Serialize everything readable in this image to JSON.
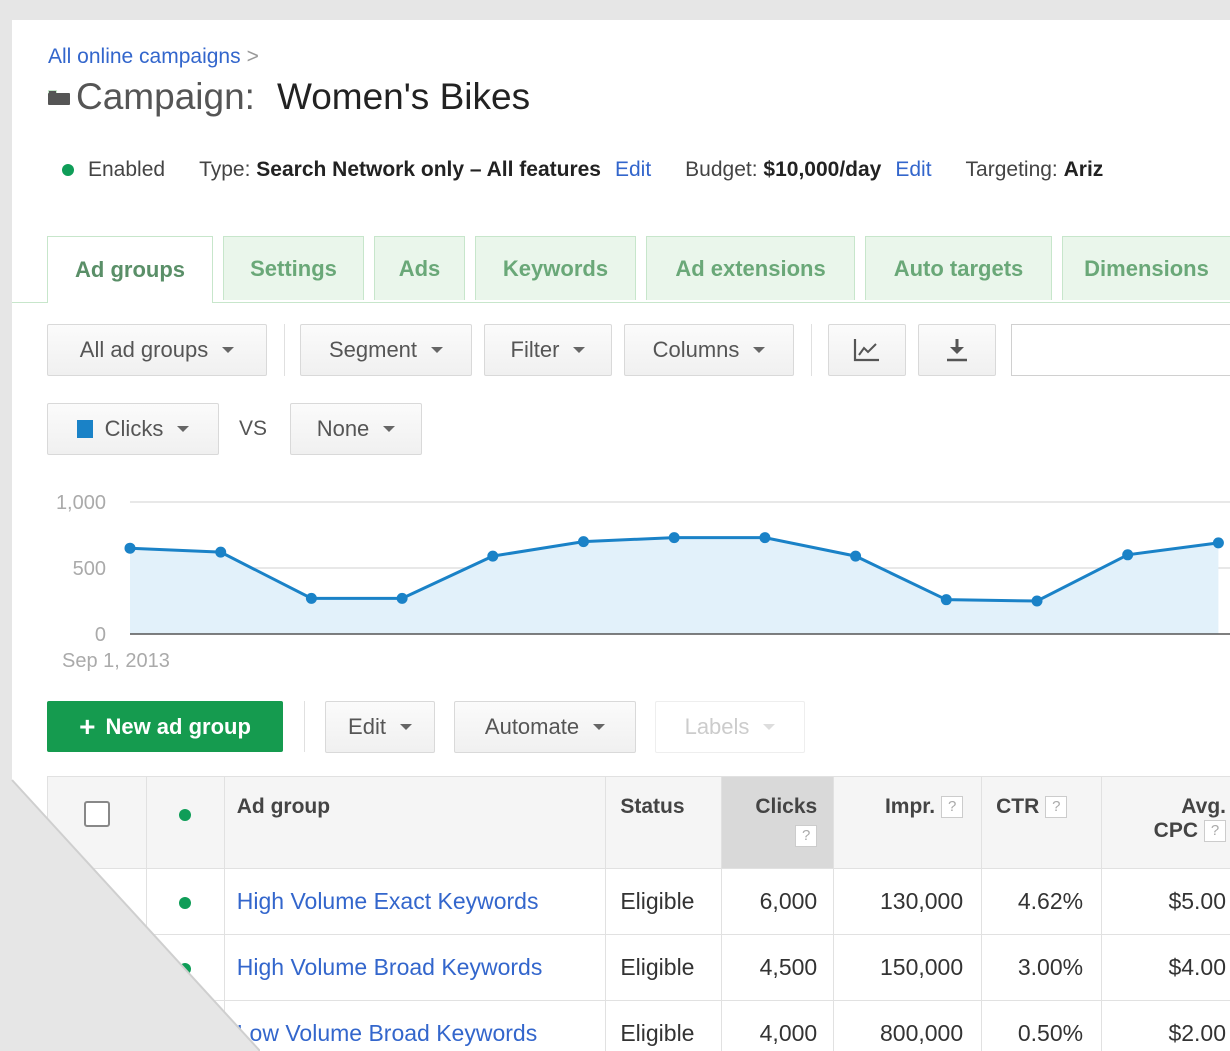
{
  "breadcrumb": {
    "parent": "All online campaigns",
    "sep": ">"
  },
  "campaign": {
    "label": "Campaign:",
    "name": "Women's Bikes"
  },
  "status_bar": {
    "status": "Enabled",
    "type_label": "Type:",
    "type_value": "Search Network only – All features",
    "edit1": "Edit",
    "budget_label": "Budget:",
    "budget_value": "$10,000/day",
    "edit2": "Edit",
    "targeting_label": "Targeting:",
    "targeting_value": "Ariz"
  },
  "tabs": [
    "Ad groups",
    "Settings",
    "Ads",
    "Keywords",
    "Ad extensions",
    "Auto targets",
    "Dimensions"
  ],
  "toolbar": {
    "all_ad_groups": "All ad groups",
    "segment": "Segment",
    "filter": "Filter",
    "columns": "Columns",
    "chart_icon": "line-chart-icon",
    "download_icon": "download-icon"
  },
  "metric_selector": {
    "primary": "Clicks",
    "vs": "VS",
    "secondary": "None"
  },
  "colors": {
    "series": "#1a82c7",
    "area": "#e2f1fa",
    "primary_green": "#159b4f",
    "link": "#3366cc"
  },
  "chart_data": {
    "type": "area",
    "x_start_label": "Sep 1, 2013",
    "y_ticks": [
      "1,000",
      "500",
      "0"
    ],
    "ylim": [
      0,
      1000
    ],
    "series": [
      {
        "values": [
          650,
          620,
          270,
          270,
          590,
          700,
          730,
          730,
          590,
          260,
          250,
          600,
          690
        ]
      }
    ],
    "grid": true
  },
  "actions": {
    "new_ad_group": "New ad group",
    "edit": "Edit",
    "automate": "Automate",
    "labels": "Labels"
  },
  "table": {
    "headers": {
      "ad_group": "Ad group",
      "status": "Status",
      "clicks": "Clicks",
      "impr": "Impr.",
      "ctr": "CTR",
      "avg": "Avg.",
      "cpc": "CPC",
      "help": "?"
    },
    "rows": [
      {
        "name": "High Volume Exact Keywords",
        "status": "Eligible",
        "clicks": "6,000",
        "impr": "130,000",
        "ctr": "4.62%",
        "cpc": "$5.00"
      },
      {
        "name": "High Volume Broad Keywords",
        "status": "Eligible",
        "clicks": "4,500",
        "impr": "150,000",
        "ctr": "3.00%",
        "cpc": "$4.00"
      },
      {
        "name": "Low Volume Broad Keywords",
        "status": "Eligible",
        "clicks": "4,000",
        "impr": "800,000",
        "ctr": "0.50%",
        "cpc": "$2.00"
      }
    ]
  }
}
